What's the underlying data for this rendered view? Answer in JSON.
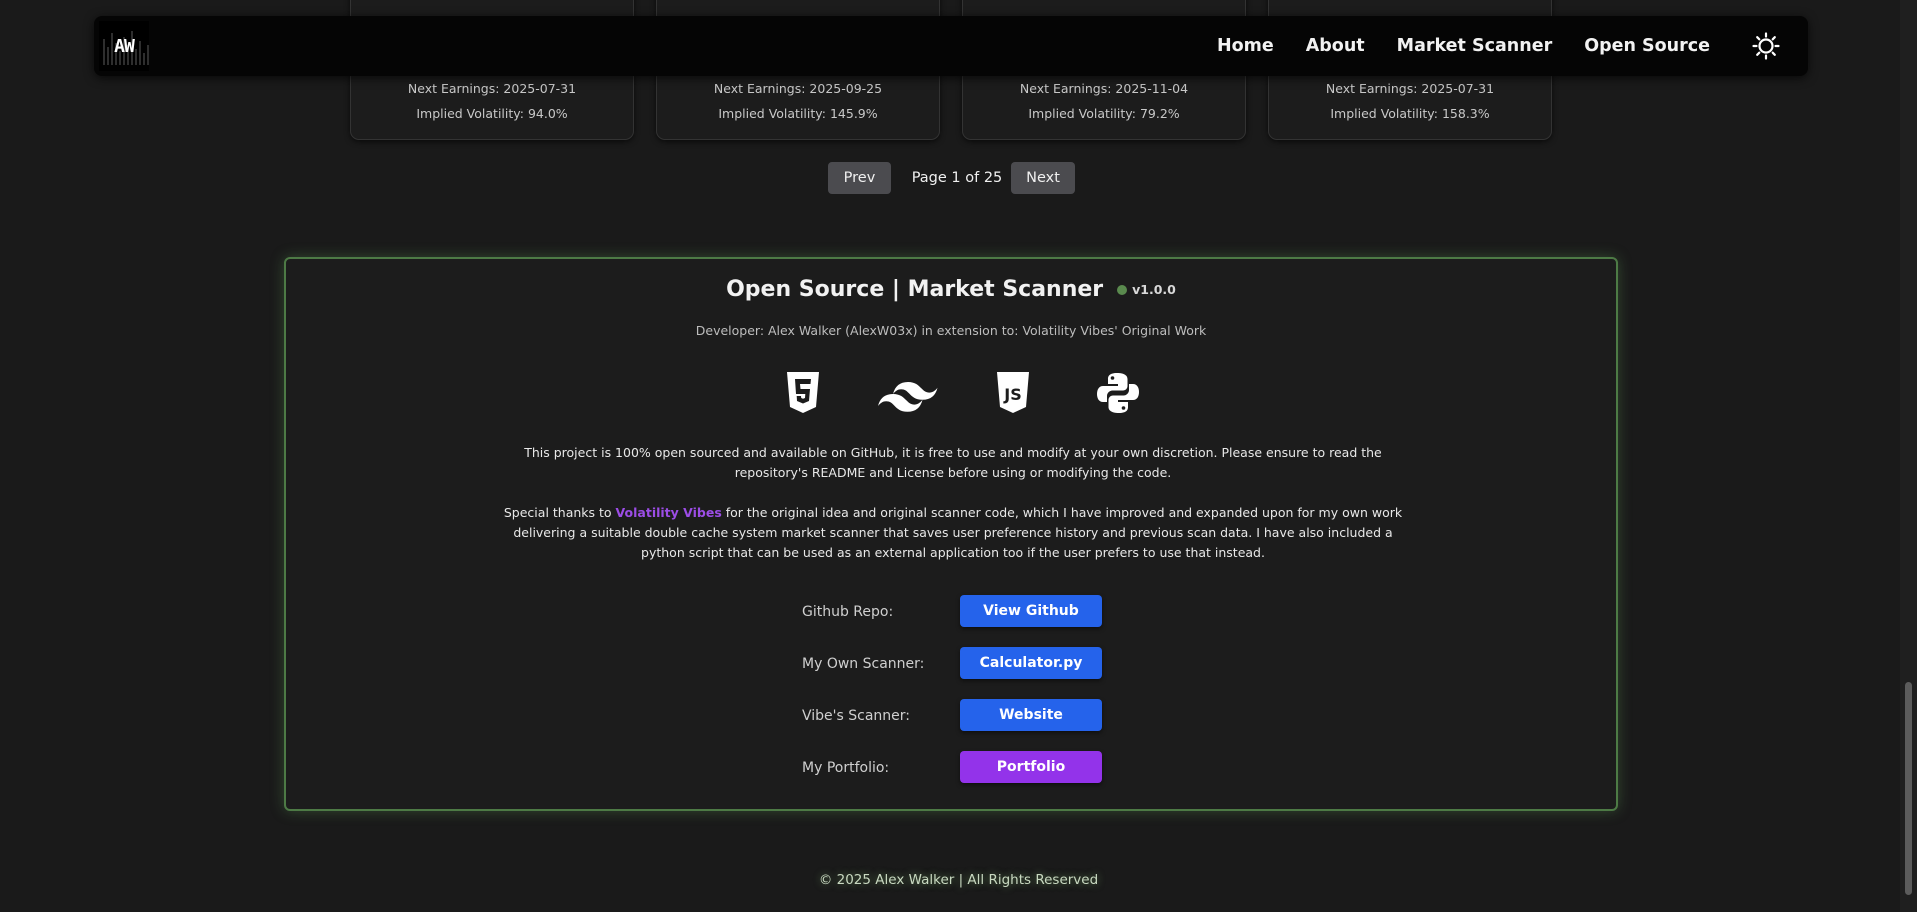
{
  "cards": [
    {
      "next_earnings": "Next Earnings: 2025-07-31",
      "implied_volatility": "Implied Volatility: 94.0%"
    },
    {
      "next_earnings": "Next Earnings: 2025-09-25",
      "implied_volatility": "Implied Volatility: 145.9%"
    },
    {
      "next_earnings": "Next Earnings: 2025-11-04",
      "implied_volatility": "Implied Volatility: 79.2%"
    },
    {
      "next_earnings": "Next Earnings: 2025-07-31",
      "implied_volatility": "Implied Volatility: 158.3%"
    }
  ],
  "nav": {
    "logo_text": "AW",
    "links": [
      "Home",
      "About",
      "Market Scanner",
      "Open Source"
    ],
    "theme_icon": "sun-icon"
  },
  "pagination": {
    "prev": "Prev",
    "info": "Page 1 of 25",
    "next": "Next"
  },
  "open_source": {
    "title": "Open Source | Market Scanner",
    "version": "v1.0.0",
    "developer": "Developer: Alex Walker (AlexW03x) in extension to: Volatility Vibes' Original Work",
    "tech_icons": [
      "html5-icon",
      "tailwind-icon",
      "javascript-icon",
      "python-icon"
    ],
    "description_1": "This project is 100% open sourced and available on GitHub, it is free to use and modify at your own discretion. Please ensure to read the repository's README and License before using or modifying the code.",
    "description_2_prefix": "Special thanks to ",
    "description_2_link": "Volatility Vibes",
    "description_2_suffix": " for the original idea and original scanner code, which I have improved and expanded upon for my own work delivering a suitable double cache system market scanner that saves user preference history and previous scan data. I have also included a python script that can be used as an external application too if the user prefers to use that instead.",
    "links": [
      {
        "label": "Github Repo:",
        "button": "View Github"
      },
      {
        "label": "My Own Scanner:",
        "button": "Calculator.py"
      },
      {
        "label": "Vibe's Scanner:",
        "button": "Website"
      },
      {
        "label": "My Portfolio:",
        "button": "Portfolio"
      }
    ]
  },
  "footer": "© 2025 Alex Walker | All Rights Reserved",
  "colors": {
    "background": "#1a1a1a",
    "accent_green": "#4d7a45",
    "button_blue": "#2563eb",
    "button_purple": "#9333ea",
    "link_purple": "#9c4de6"
  }
}
